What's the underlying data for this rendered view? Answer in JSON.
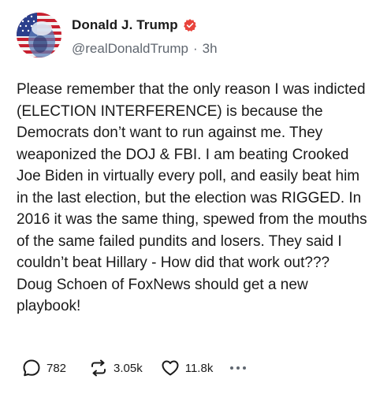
{
  "post": {
    "author": {
      "display_name": "Donald J. Trump",
      "handle": "@realDonaldTrump",
      "verified": true,
      "verified_color": "#e8443c"
    },
    "separator": "·",
    "time_ago": "3h",
    "text": "Please remember that the only reason I was indicted (ELECTION INTERFERENCE) is because the Democrats don’t want to run against me. They weaponized the DOJ & FBI. I am beating Crooked Joe Biden in virtually every poll, and easily beat him in the last election, but the election was RIGGED. In 2016 it was the same thing, spewed from the mouths of the same failed pundits and losers. They said I couldn’t beat Hillary - How did that work out??? Doug Schoen of FoxNews should get a new playbook!",
    "actions": {
      "reply": {
        "icon": "reply-icon",
        "count": "782"
      },
      "retruth": {
        "icon": "retruth-icon",
        "count": "3.05k"
      },
      "like": {
        "icon": "heart-icon",
        "count": "11.8k"
      },
      "more": {
        "icon": "more-icon"
      }
    }
  }
}
